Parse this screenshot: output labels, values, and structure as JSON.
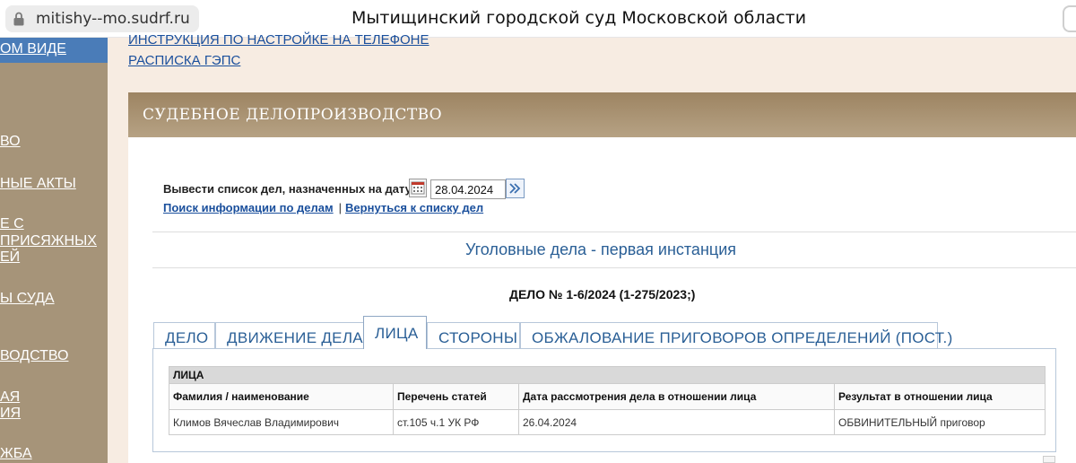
{
  "browser": {
    "url": "mitishy--mo.sudrf.ru",
    "title": "Мытищинский городской суд Московской области"
  },
  "sidebar": {
    "items": [
      {
        "label": "ОМ ВИДЕ"
      },
      {
        "label": "ВО"
      },
      {
        "label": "НЫЕ АКТЫ"
      },
      {
        "label": "Е С"
      },
      {
        "label": "ПРИСЯЖНЫХ"
      },
      {
        "label": "ЕЙ"
      },
      {
        "label": "Ы СУДА"
      },
      {
        "label": "ВОДСТВО"
      },
      {
        "label": "АЯ"
      },
      {
        "label": "ИЯ"
      },
      {
        "label": "ЖБА"
      }
    ]
  },
  "header": {
    "link1": "ИНСТРУКЦИЯ ПО НАСТРОЙКЕ НА ТЕЛЕФОНЕ",
    "link2": "РАСПИСКА ГЭПС"
  },
  "section": {
    "title": "СУДЕБНОЕ ДЕЛОПРОИЗВОДСТВО"
  },
  "filter": {
    "label": "Вывести список дел, назначенных на дату",
    "date": "28.04.2024",
    "search_link": "Поиск информации по делам",
    "separator": "|",
    "back_link": "Вернуться к списку дел"
  },
  "case": {
    "category": "Уголовные дела - первая инстанция",
    "number": "ДЕЛО № 1-6/2024 (1-275/2023;)"
  },
  "tabs": [
    {
      "label": "ДЕЛО"
    },
    {
      "label": "ДВИЖЕНИЕ ДЕЛА"
    },
    {
      "label": "ЛИЦА"
    },
    {
      "label": "СТОРОНЫ"
    },
    {
      "label": "ОБЖАЛОВАНИЕ ПРИГОВОРОВ ОПРЕДЕЛЕНИЙ (ПОСТ.)"
    }
  ],
  "active_tab": "ЛИЦА",
  "persons_table": {
    "caption": "ЛИЦА",
    "headers": [
      "Фамилия / наименование",
      "Перечень статей",
      "Дата рассмотрения дела в отношении лица",
      "Результат в отношении лица"
    ],
    "rows": [
      [
        "Климов Вячеслав Владимирович",
        "ст.105 ч.1 УК РФ",
        "26.04.2024",
        "ОБВИНИТЕЛЬНЫЙ приговор"
      ]
    ]
  },
  "colors": {
    "sidebar": "#a69479",
    "sidebar_active": "#4a7cb8",
    "link": "#1a4f9c",
    "tab_text": "#2a5f96",
    "section_bar": "#9d8462",
    "page_bg": "#f7ece2"
  }
}
